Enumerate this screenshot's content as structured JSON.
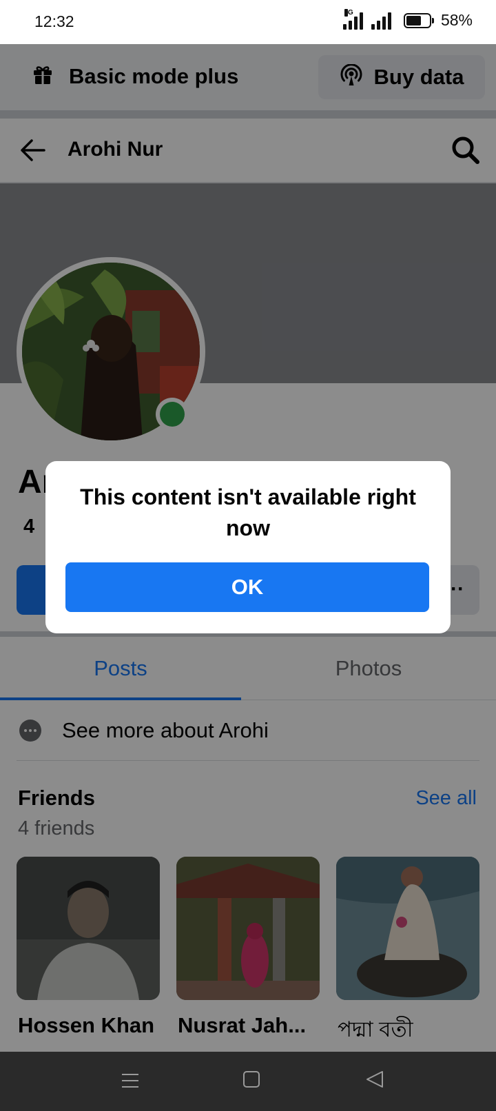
{
  "status_bar": {
    "time": "12:32",
    "network": "4G",
    "battery_percent": "58%",
    "battery_level": 0.58
  },
  "mode_bar": {
    "label": "Basic mode plus",
    "buy_label": "Buy data"
  },
  "header": {
    "title": "Arohi Nur"
  },
  "profile": {
    "name_visible": "Ar",
    "friend_count_visible": "4"
  },
  "dialog": {
    "message": "This content isn't available right now",
    "ok_label": "OK"
  },
  "tabs": [
    {
      "label": "Posts",
      "active": true
    },
    {
      "label": "Photos",
      "active": false
    }
  ],
  "see_more": {
    "label": "See more about Arohi"
  },
  "friends": {
    "title": "Friends",
    "see_all": "See all",
    "count": "4 friends",
    "items": [
      {
        "name": "Hossen Khan"
      },
      {
        "name": "Nusrat Jah..."
      },
      {
        "name": "পদ্মা বতী"
      }
    ]
  },
  "colors": {
    "accent": "#1877f2",
    "online": "#31a24c"
  },
  "icons": [
    "gift-icon",
    "broadcast-icon",
    "back-arrow-icon",
    "search-icon",
    "more-dots-icon",
    "nav-menu-icon",
    "nav-home-icon",
    "nav-back-icon"
  ]
}
